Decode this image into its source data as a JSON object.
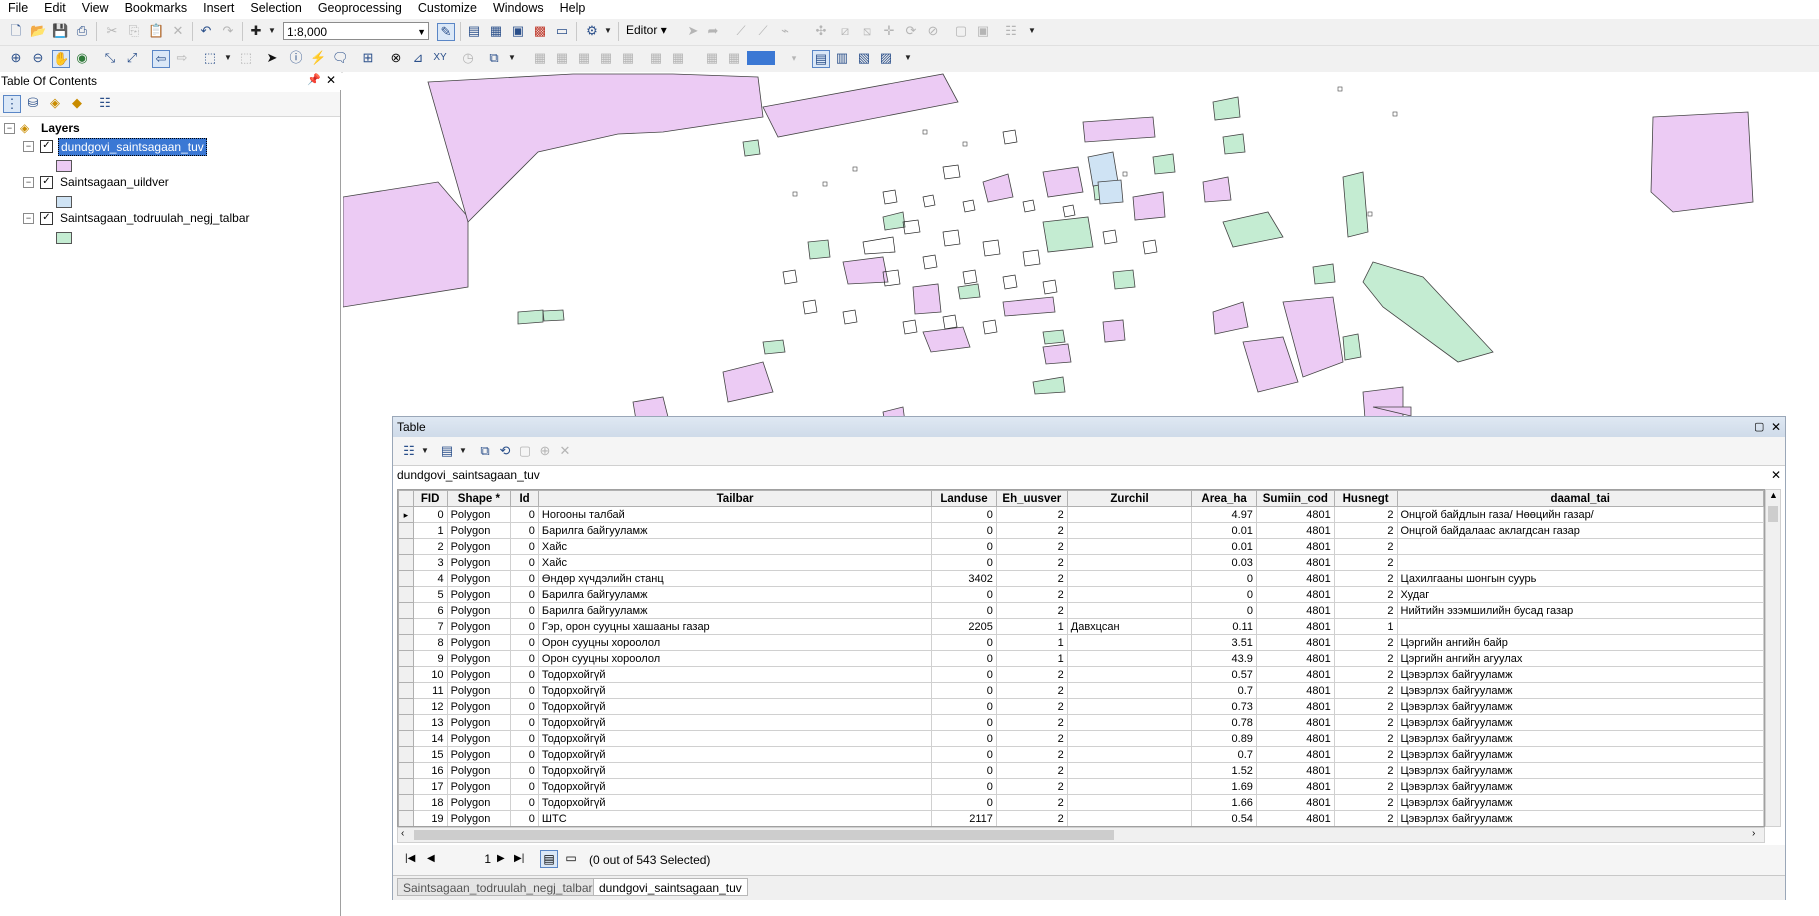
{
  "menu": [
    "File",
    "Edit",
    "View",
    "Bookmarks",
    "Insert",
    "Selection",
    "Geoprocessing",
    "Customize",
    "Windows",
    "Help"
  ],
  "toolbar": {
    "scale_value": "1:8,000",
    "editor_label": "Editor"
  },
  "toc": {
    "title": "Table Of Contents",
    "root_label": "Layers",
    "layers": [
      {
        "name": "dundgovi_saintsagaan_tuv",
        "color": "#eccbf4"
      },
      {
        "name": "Saintsagaan_uildver",
        "color": "#cfe3f4"
      },
      {
        "name": "Saintsagaan_todruulah_negj_talbar",
        "color": "#c4ecd2"
      }
    ]
  },
  "table": {
    "window_title": "Table",
    "layer_name": "dundgovi_saintsagaan_tuv",
    "columns": [
      "FID",
      "Shape *",
      "Id",
      "Tailbar",
      "Landuse",
      "Eh_uusver",
      "Zurchil",
      "Area_ha",
      "Sumiin_cod",
      "Husnegt",
      "daamal_tai"
    ],
    "rows": [
      [
        "0",
        "Polygon",
        "0",
        "Ногооны талбай",
        "0",
        "2",
        "",
        "4.97",
        "4801",
        "2",
        "Онцгой байдлын газа/ Нөөцийн газар/"
      ],
      [
        "1",
        "Polygon",
        "0",
        "Барилга байгууламж",
        "0",
        "2",
        "",
        "0.01",
        "4801",
        "2",
        "Онцгой байдалаас аклагдсан газар"
      ],
      [
        "2",
        "Polygon",
        "0",
        "Хайс",
        "0",
        "2",
        "",
        "0.01",
        "4801",
        "2",
        ""
      ],
      [
        "3",
        "Polygon",
        "0",
        "Хайс",
        "0",
        "2",
        "",
        "0.03",
        "4801",
        "2",
        ""
      ],
      [
        "4",
        "Polygon",
        "0",
        "Өндөр хүчдэлийн станц",
        "3402",
        "2",
        "",
        "0",
        "4801",
        "2",
        "Цахилгааны шонгын суурь"
      ],
      [
        "5",
        "Polygon",
        "0",
        "Барилга байгууламж",
        "0",
        "2",
        "",
        "0",
        "4801",
        "2",
        "Худаг"
      ],
      [
        "6",
        "Polygon",
        "0",
        "Барилга байгууламж",
        "0",
        "2",
        "",
        "0",
        "4801",
        "2",
        "Нийтийн эзэмшилийн бусад газар"
      ],
      [
        "7",
        "Polygon",
        "0",
        "Гэр, орон сууцны хашааны газар",
        "2205",
        "1",
        "Давхцсан",
        "0.11",
        "4801",
        "1",
        ""
      ],
      [
        "8",
        "Polygon",
        "0",
        "Орон сууцны хороолол",
        "0",
        "1",
        "",
        "3.51",
        "4801",
        "2",
        "Цэргийн ангийн байр"
      ],
      [
        "9",
        "Polygon",
        "0",
        "Орон сууцны хороолол",
        "0",
        "1",
        "",
        "43.9",
        "4801",
        "2",
        "Цэргийн ангийн агуулах"
      ],
      [
        "10",
        "Polygon",
        "0",
        "Тодорхойгүй",
        "0",
        "2",
        "",
        "0.57",
        "4801",
        "2",
        "Цэвэрлэх байгууламж"
      ],
      [
        "11",
        "Polygon",
        "0",
        "Тодорхойгүй",
        "0",
        "2",
        "",
        "0.7",
        "4801",
        "2",
        "Цэвэрлэх байгууламж"
      ],
      [
        "12",
        "Polygon",
        "0",
        "Тодорхойгүй",
        "0",
        "2",
        "",
        "0.73",
        "4801",
        "2",
        "Цэвэрлэх байгууламж"
      ],
      [
        "13",
        "Polygon",
        "0",
        "Тодорхойгүй",
        "0",
        "2",
        "",
        "0.78",
        "4801",
        "2",
        "Цэвэрлэх байгууламж"
      ],
      [
        "14",
        "Polygon",
        "0",
        "Тодорхойгүй",
        "0",
        "2",
        "",
        "0.89",
        "4801",
        "2",
        "Цэвэрлэх байгууламж"
      ],
      [
        "15",
        "Polygon",
        "0",
        "Тодорхойгүй",
        "0",
        "2",
        "",
        "0.7",
        "4801",
        "2",
        "Цэвэрлэх байгууламж"
      ],
      [
        "16",
        "Polygon",
        "0",
        "Тодорхойгүй",
        "0",
        "2",
        "",
        "1.52",
        "4801",
        "2",
        "Цэвэрлэх байгууламж"
      ],
      [
        "17",
        "Polygon",
        "0",
        "Тодорхойгүй",
        "0",
        "2",
        "",
        "1.69",
        "4801",
        "2",
        "Цэвэрлэх байгууламж"
      ],
      [
        "18",
        "Polygon",
        "0",
        "Тодорхойгүй",
        "0",
        "2",
        "",
        "1.66",
        "4801",
        "2",
        "Цэвэрлэх байгууламж"
      ],
      [
        "19",
        "Polygon",
        "0",
        "ШТС",
        "2117",
        "2",
        "",
        "0.54",
        "4801",
        "2",
        "Цэвэрлэх байгууламж"
      ]
    ],
    "record_position": "1",
    "selection_status": "(0 out of 543 Selected)",
    "tabs": [
      "Saintsagaan_todruulah_negj_talbar",
      "dundgovi_saintsagaan_tuv"
    ]
  },
  "colors": {
    "landuse_fill": "#eccbf4",
    "green_fill": "#c4ecd2",
    "blue_fill": "#cfe3f4",
    "selection_highlight": "#3b78d4"
  }
}
